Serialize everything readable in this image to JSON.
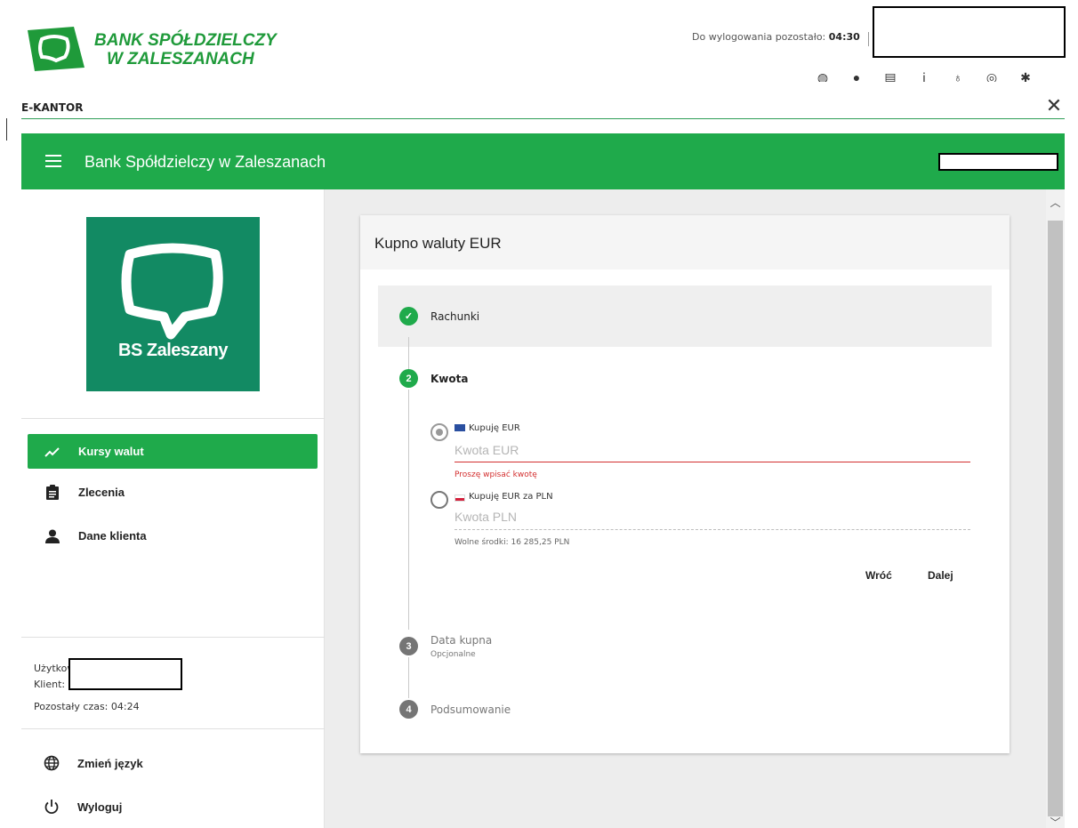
{
  "header": {
    "bank_name_line1": "BANK SPÓŁDZIELCZY",
    "bank_name_line2": "W ZALESZANACH",
    "logout_label": "Do wylogowania pozostało:",
    "logout_time": "04:30",
    "brand_color": "#1faa4b",
    "icons": [
      "globe-icon",
      "person-icon",
      "document-icon",
      "info-icon",
      "key-icon",
      "help-icon",
      "gear-icon"
    ]
  },
  "overlay": {
    "title": "E-KANTOR",
    "close_glyph": "✕"
  },
  "app_bar": {
    "title": "Bank Spółdzielczy w Zaleszanach"
  },
  "sidebar": {
    "logo_text": "BS Zaleszany",
    "nav": [
      {
        "label": "Kursy walut",
        "icon": "trending-up-icon",
        "active": true
      },
      {
        "label": "Zlecenia",
        "icon": "clipboard-icon",
        "active": false
      },
      {
        "label": "Dane klienta",
        "icon": "person-icon",
        "active": false
      }
    ],
    "user_label": "Użytkow",
    "client_label": "Klient:",
    "remaining_time": "Pozostały czas: 04:24",
    "bottom": [
      {
        "label": "Zmień język",
        "icon": "globe-icon"
      },
      {
        "label": "Wyloguj",
        "icon": "power-icon"
      }
    ]
  },
  "card": {
    "title": "Kupno waluty EUR",
    "steps": [
      {
        "number": "✓",
        "label": "Rachunki",
        "state": "done"
      },
      {
        "number": "2",
        "label": "Kwota",
        "state": "active"
      },
      {
        "number": "3",
        "label": "Data kupna",
        "sublabel": "Opcjonalne",
        "state": "pending"
      },
      {
        "number": "4",
        "label": "Podsumowanie",
        "state": "pending"
      }
    ],
    "option_eur": {
      "label": "Kupuję EUR",
      "placeholder": "Kwota EUR",
      "value": "",
      "error": "Proszę wpisać kwotę",
      "selected": true
    },
    "option_pln": {
      "label": "Kupuję EUR za PLN",
      "placeholder": "Kwota PLN",
      "value": "",
      "selected": false
    },
    "available_funds": "Wolne środki: 16 285,25 PLN",
    "back_button": "Wróć",
    "next_button": "Dalej"
  }
}
